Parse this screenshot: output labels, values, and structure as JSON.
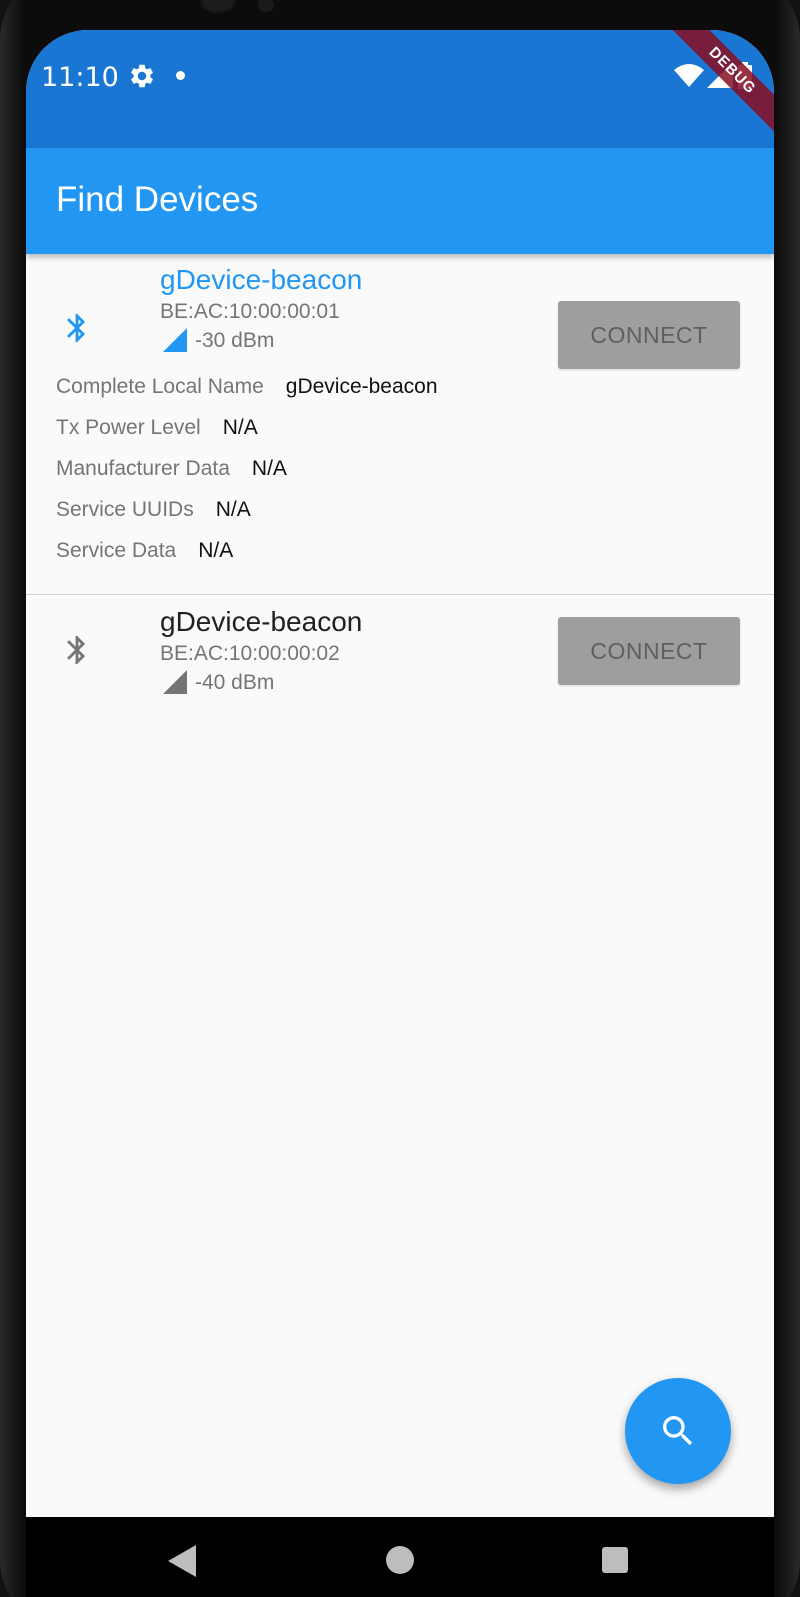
{
  "status_bar": {
    "time": "11:10",
    "icons": [
      "gear-icon",
      "notification-dot-icon",
      "wifi-icon",
      "signal-icon",
      "battery-icon"
    ],
    "debug_banner": "DEBUG"
  },
  "app_bar": {
    "title": "Find Devices"
  },
  "devices": [
    {
      "name": "gDevice-beacon",
      "mac": "BE:AC:10:00:00:01",
      "rssi": "-30 dBm",
      "connect_label": "CONNECT",
      "expanded": true,
      "accent_color": "#2196f3",
      "advertisement": [
        {
          "label": "Complete Local Name",
          "value": "gDevice-beacon"
        },
        {
          "label": "Tx Power Level",
          "value": "N/A"
        },
        {
          "label": "Manufacturer Data",
          "value": "N/A"
        },
        {
          "label": "Service UUIDs",
          "value": "N/A"
        },
        {
          "label": "Service Data",
          "value": "N/A"
        }
      ]
    },
    {
      "name": "gDevice-beacon",
      "mac": "BE:AC:10:00:00:02",
      "rssi": "-40 dBm",
      "connect_label": "CONNECT",
      "expanded": false,
      "accent_color": "#757575"
    }
  ],
  "fab": {
    "icon": "search-icon"
  },
  "nav_bar": {
    "icons": [
      "back-icon",
      "home-icon",
      "recents-icon"
    ]
  },
  "colors": {
    "status_bar": "#1976d2",
    "app_bar": "#2196f3",
    "button_disabled": "#9e9e9e",
    "secondary_text": "#757575"
  }
}
